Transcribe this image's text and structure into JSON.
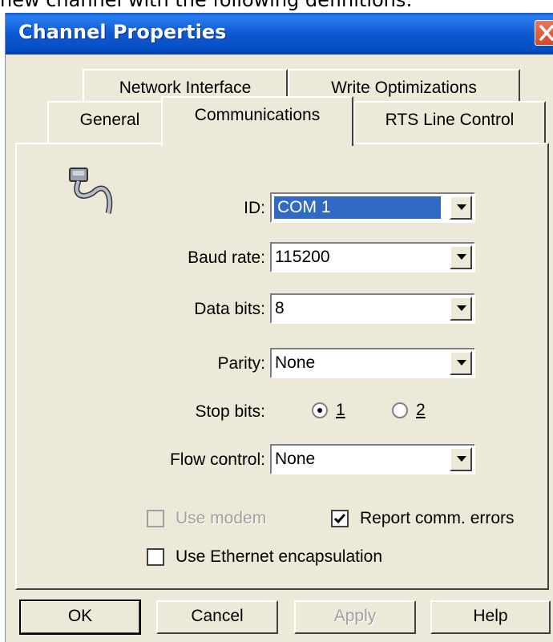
{
  "background_text": "new channel with the following definitions:",
  "window": {
    "title": "Channel Properties",
    "close_icon": "close-icon"
  },
  "tabs": {
    "row1": [
      {
        "label": "Network Interface"
      },
      {
        "label": "Write Optimizations"
      }
    ],
    "row2": [
      {
        "label": "General"
      },
      {
        "label": "Communications",
        "selected": true
      },
      {
        "label": "RTS Line Control"
      }
    ]
  },
  "form": {
    "icon": "serial-cable-icon",
    "id_label": "ID:",
    "id_value": "COM 1",
    "baud_label": "Baud rate:",
    "baud_value": "115200",
    "databits_label": "Data bits:",
    "databits_value": "8",
    "parity_label": "Parity:",
    "parity_value": "None",
    "stopbits_label": "Stop bits:",
    "stopbits_options": [
      {
        "label": "1",
        "selected": true
      },
      {
        "label": "2",
        "selected": false
      }
    ],
    "flow_label": "Flow control:",
    "flow_value": "None",
    "use_modem_label": "Use modem",
    "use_modem_checked": false,
    "use_modem_enabled": false,
    "report_errors_label": "Report comm. errors",
    "report_errors_checked": true,
    "ethernet_label": "Use Ethernet encapsulation",
    "ethernet_checked": false
  },
  "buttons": {
    "ok": "OK",
    "cancel": "Cancel",
    "apply": "Apply",
    "help": "Help"
  },
  "colors": {
    "titlebar": "#0a5fd6",
    "dialog_bg": "#ece9d8",
    "selection": "#316ac5",
    "close_button": "#d24a2c"
  }
}
